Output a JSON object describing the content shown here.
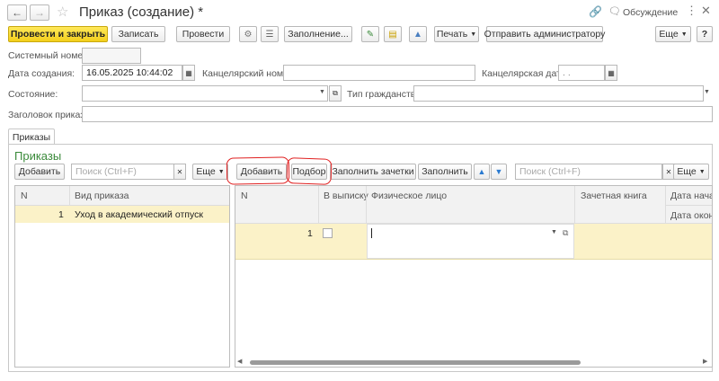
{
  "window": {
    "title": "Приказ (создание) *",
    "discussion_label": "Обсуждение"
  },
  "toolbar": {
    "post_and_close": "Провести и закрыть",
    "save": "Записать",
    "post": "Провести",
    "fill": "Заполнение...",
    "print": "Печать",
    "send_admin": "Отправить администратору",
    "more": "Еще"
  },
  "form": {
    "system_number_label": "Системный номер:",
    "system_number_value": "",
    "created_label": "Дата создания:",
    "created_value": "16.05.2025 10:44:02",
    "office_number_label": "Канцелярский номер:",
    "office_number_value": "",
    "office_date_label": "Канцелярская дата:",
    "office_date_value": " .  .",
    "state_label": "Состояние:",
    "state_value": "",
    "citizenship_label": "Тип гражданства:",
    "citizenship_value": "",
    "header_label": "Заголовок приказа:",
    "header_value": ""
  },
  "tabs": [
    {
      "label": "Приказы"
    }
  ],
  "section_title": "Приказы",
  "left_panel": {
    "add": "Добавить",
    "search_placeholder": "Поиск (Ctrl+F)",
    "more": "Еще",
    "columns": [
      "N",
      "Вид приказа"
    ],
    "rows": [
      {
        "n": "1",
        "kind": "Уход в академический отпуск"
      }
    ]
  },
  "right_panel": {
    "add": "Добавить",
    "select": "Подбор",
    "fill_records": "Заполнить зачетки",
    "fill": "Заполнить",
    "search_placeholder": "Поиск (Ctrl+F)",
    "more": "Еще",
    "columns": [
      "N",
      "В выписку",
      "Физическое лицо",
      "Зачетная книга",
      "Дата нача",
      "Дата окон"
    ],
    "rows": [
      {
        "n": "1",
        "in_extract": false,
        "person": "",
        "record_book": ""
      }
    ]
  },
  "colors": {
    "accent_green": "#3a8a3a",
    "highlight_row": "#fbf2c8",
    "primary_button": "#f3cf1c",
    "annotation_red": "#e02020"
  }
}
